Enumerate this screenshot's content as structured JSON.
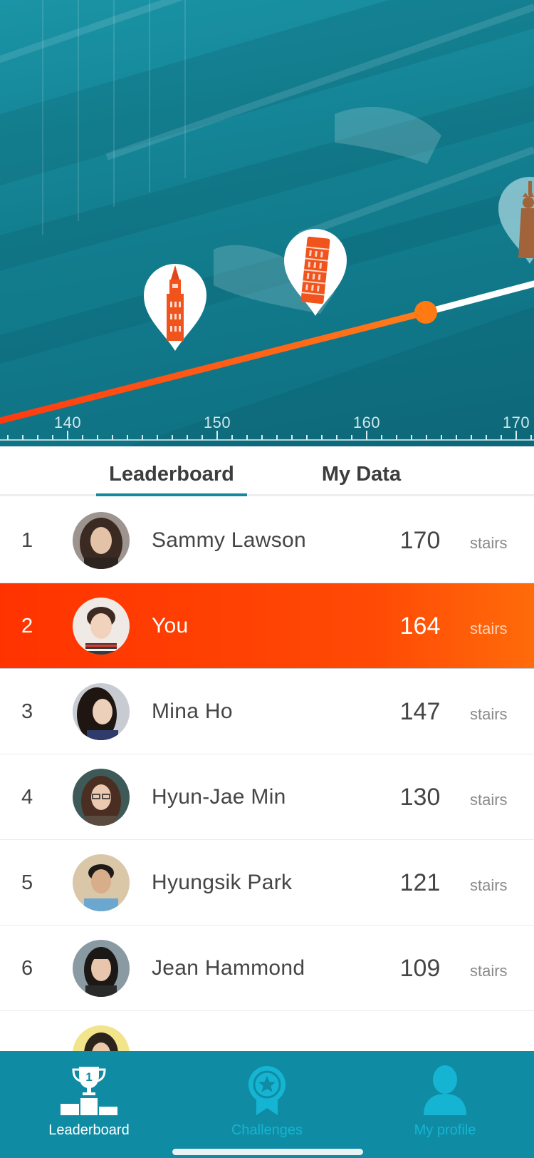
{
  "progress": {
    "ruler_labels": [
      "140",
      "150",
      "160",
      "170"
    ],
    "current_value": 164,
    "landmarks": [
      "tower-landmark-icon",
      "leaning-tower-landmark-icon",
      "statue-of-liberty-landmark-icon"
    ]
  },
  "tabs": [
    {
      "label": "Leaderboard",
      "active": true
    },
    {
      "label": "My Data",
      "active": false
    }
  ],
  "leaderboard": [
    {
      "rank": "1",
      "name": "Sammy Lawson",
      "score": "170",
      "unit": "stairs",
      "highlighted": false
    },
    {
      "rank": "2",
      "name": "You",
      "score": "164",
      "unit": "stairs",
      "highlighted": true
    },
    {
      "rank": "3",
      "name": "Mina Ho",
      "score": "147",
      "unit": "stairs",
      "highlighted": false
    },
    {
      "rank": "4",
      "name": "Hyun-Jae Min",
      "score": "130",
      "unit": "stairs",
      "highlighted": false
    },
    {
      "rank": "5",
      "name": "Hyungsik Park",
      "score": "121",
      "unit": "stairs",
      "highlighted": false
    },
    {
      "rank": "6",
      "name": "Jean Hammond",
      "score": "109",
      "unit": "stairs",
      "highlighted": false
    }
  ],
  "bottom_nav": [
    {
      "label": "Leaderboard",
      "icon": "trophy-podium-icon",
      "badge": "1",
      "active": true
    },
    {
      "label": "Challenges",
      "icon": "medal-star-icon",
      "active": false
    },
    {
      "label": "My profile",
      "icon": "person-icon",
      "active": false
    }
  ],
  "colors": {
    "accent": "#ff4200",
    "teal": "#0f8ca3",
    "inactive_nav": "#15b4d3"
  }
}
